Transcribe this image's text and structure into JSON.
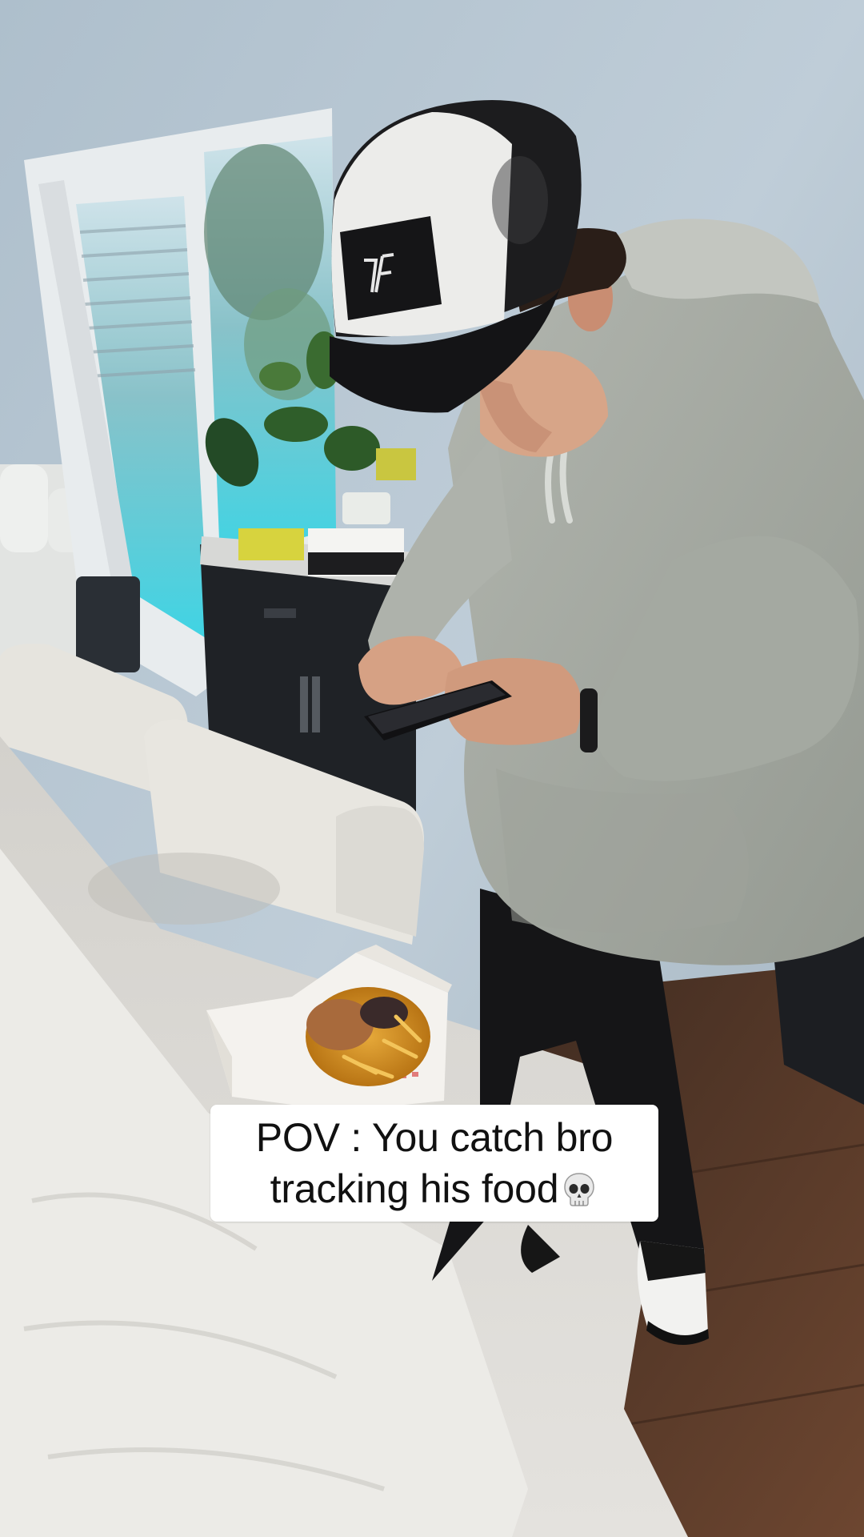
{
  "caption": {
    "line1": "POV : You catch bro",
    "line2": "tracking his food",
    "emoji": "skull-icon"
  },
  "colors": {
    "wall": "#b8c7d3",
    "hoodie": "#a9aea6",
    "cap_white": "#e9e9e7",
    "cap_black": "#1c1c1e",
    "table": "#dcdad5",
    "floor": "#5a3a28",
    "fries": "#d99a2b",
    "caption_bg": "#ffffff",
    "caption_text": "#111111"
  }
}
